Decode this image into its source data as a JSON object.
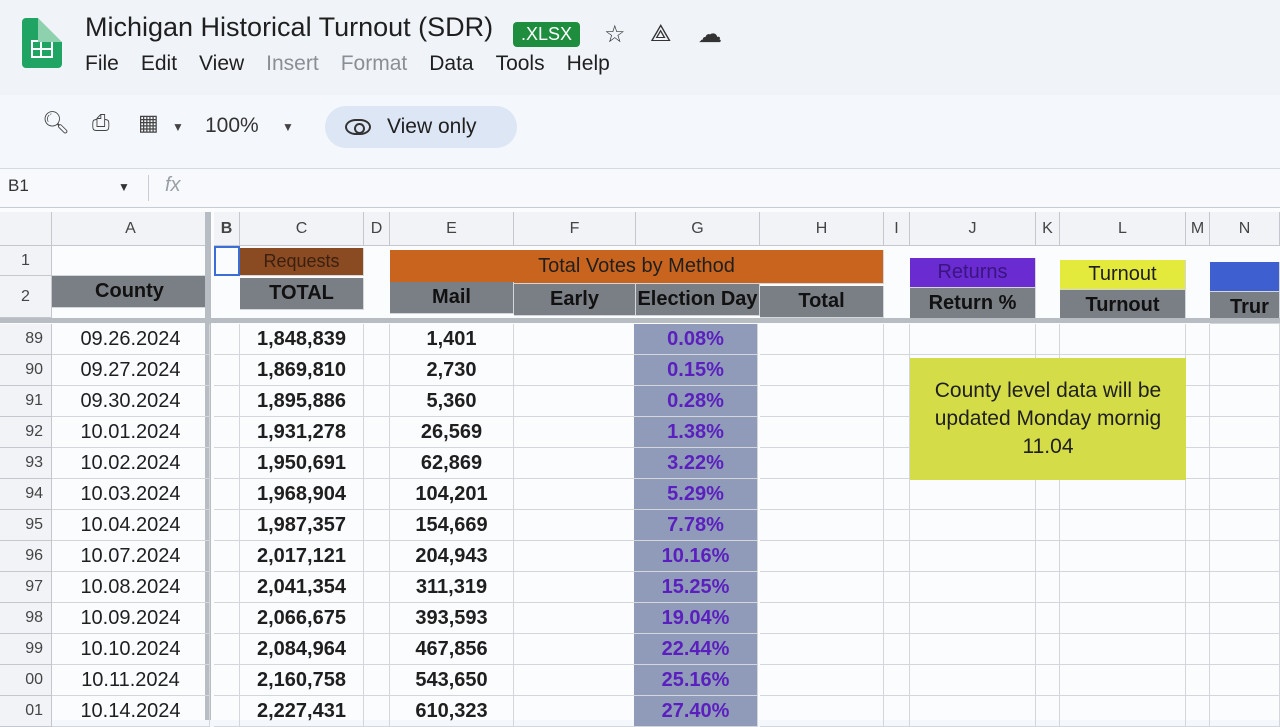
{
  "app": {
    "doc_title": "Michigan Historical Turnout (SDR)",
    "file_badge": ".XLSX",
    "header_icons": [
      "star-icon",
      "move-to-drive-icon",
      "cloud-status-icon"
    ],
    "menu": [
      {
        "label": "File",
        "enabled": true
      },
      {
        "label": "Edit",
        "enabled": true
      },
      {
        "label": "View",
        "enabled": true
      },
      {
        "label": "Insert",
        "enabled": false
      },
      {
        "label": "Format",
        "enabled": false
      },
      {
        "label": "Data",
        "enabled": true
      },
      {
        "label": "Tools",
        "enabled": true
      },
      {
        "label": "Help",
        "enabled": true
      }
    ]
  },
  "toolbar": {
    "zoom": "100%",
    "view_only_label": "View only"
  },
  "formula_bar": {
    "name_box": "B1",
    "fx_label": "fx",
    "value": ""
  },
  "columns": [
    "A",
    "B",
    "C",
    "D",
    "E",
    "F",
    "G",
    "H",
    "I",
    "J",
    "K",
    "L",
    "M",
    "N"
  ],
  "frozen_rows": {
    "row_numbers": [
      "1",
      "2"
    ],
    "row1": {
      "C": "Requests",
      "E_H": "Total Votes by Method",
      "J": "Returns",
      "L": "Turnout"
    },
    "row2": {
      "A": "County",
      "C": "TOTAL",
      "E": "Mail",
      "F": "Early",
      "G": "Election Day",
      "H": "Total",
      "J": "Return %",
      "L": "Turnout",
      "N": "Trur"
    }
  },
  "colors": {
    "requests_header": "#8a4a22",
    "total_votes_header": "#c8641e",
    "returns_header": "#6a2bd0",
    "turnout_header": "#e4ea3c",
    "n_header": "#3e5fd0",
    "dark_header": "#6f737a",
    "pct_text": "#5b1fbf",
    "note_bg": "#d4dc48"
  },
  "rows": [
    {
      "row": "89",
      "date": "09.26.2024",
      "requests": "1,848,839",
      "mail": "1,401",
      "pct": "0.08%"
    },
    {
      "row": "90",
      "date": "09.27.2024",
      "requests": "1,869,810",
      "mail": "2,730",
      "pct": "0.15%"
    },
    {
      "row": "91",
      "date": "09.30.2024",
      "requests": "1,895,886",
      "mail": "5,360",
      "pct": "0.28%"
    },
    {
      "row": "92",
      "date": "10.01.2024",
      "requests": "1,931,278",
      "mail": "26,569",
      "pct": "1.38%"
    },
    {
      "row": "93",
      "date": "10.02.2024",
      "requests": "1,950,691",
      "mail": "62,869",
      "pct": "3.22%"
    },
    {
      "row": "94",
      "date": "10.03.2024",
      "requests": "1,968,904",
      "mail": "104,201",
      "pct": "5.29%"
    },
    {
      "row": "95",
      "date": "10.04.2024",
      "requests": "1,987,357",
      "mail": "154,669",
      "pct": "7.78%"
    },
    {
      "row": "96",
      "date": "10.07.2024",
      "requests": "2,017,121",
      "mail": "204,943",
      "pct": "10.16%"
    },
    {
      "row": "97",
      "date": "10.08.2024",
      "requests": "2,041,354",
      "mail": "311,319",
      "pct": "15.25%"
    },
    {
      "row": "98",
      "date": "10.09.2024",
      "requests": "2,066,675",
      "mail": "393,593",
      "pct": "19.04%"
    },
    {
      "row": "99",
      "date": "10.10.2024",
      "requests": "2,084,964",
      "mail": "467,856",
      "pct": "22.44%"
    },
    {
      "row": "00",
      "date": "10.11.2024",
      "requests": "2,160,758",
      "mail": "543,650",
      "pct": "25.16%"
    },
    {
      "row": "01",
      "date": "10.14.2024",
      "requests": "2,227,431",
      "mail": "610,323",
      "pct": "27.40%"
    }
  ],
  "note": "County level data will be updated Monday mornig 11.04"
}
